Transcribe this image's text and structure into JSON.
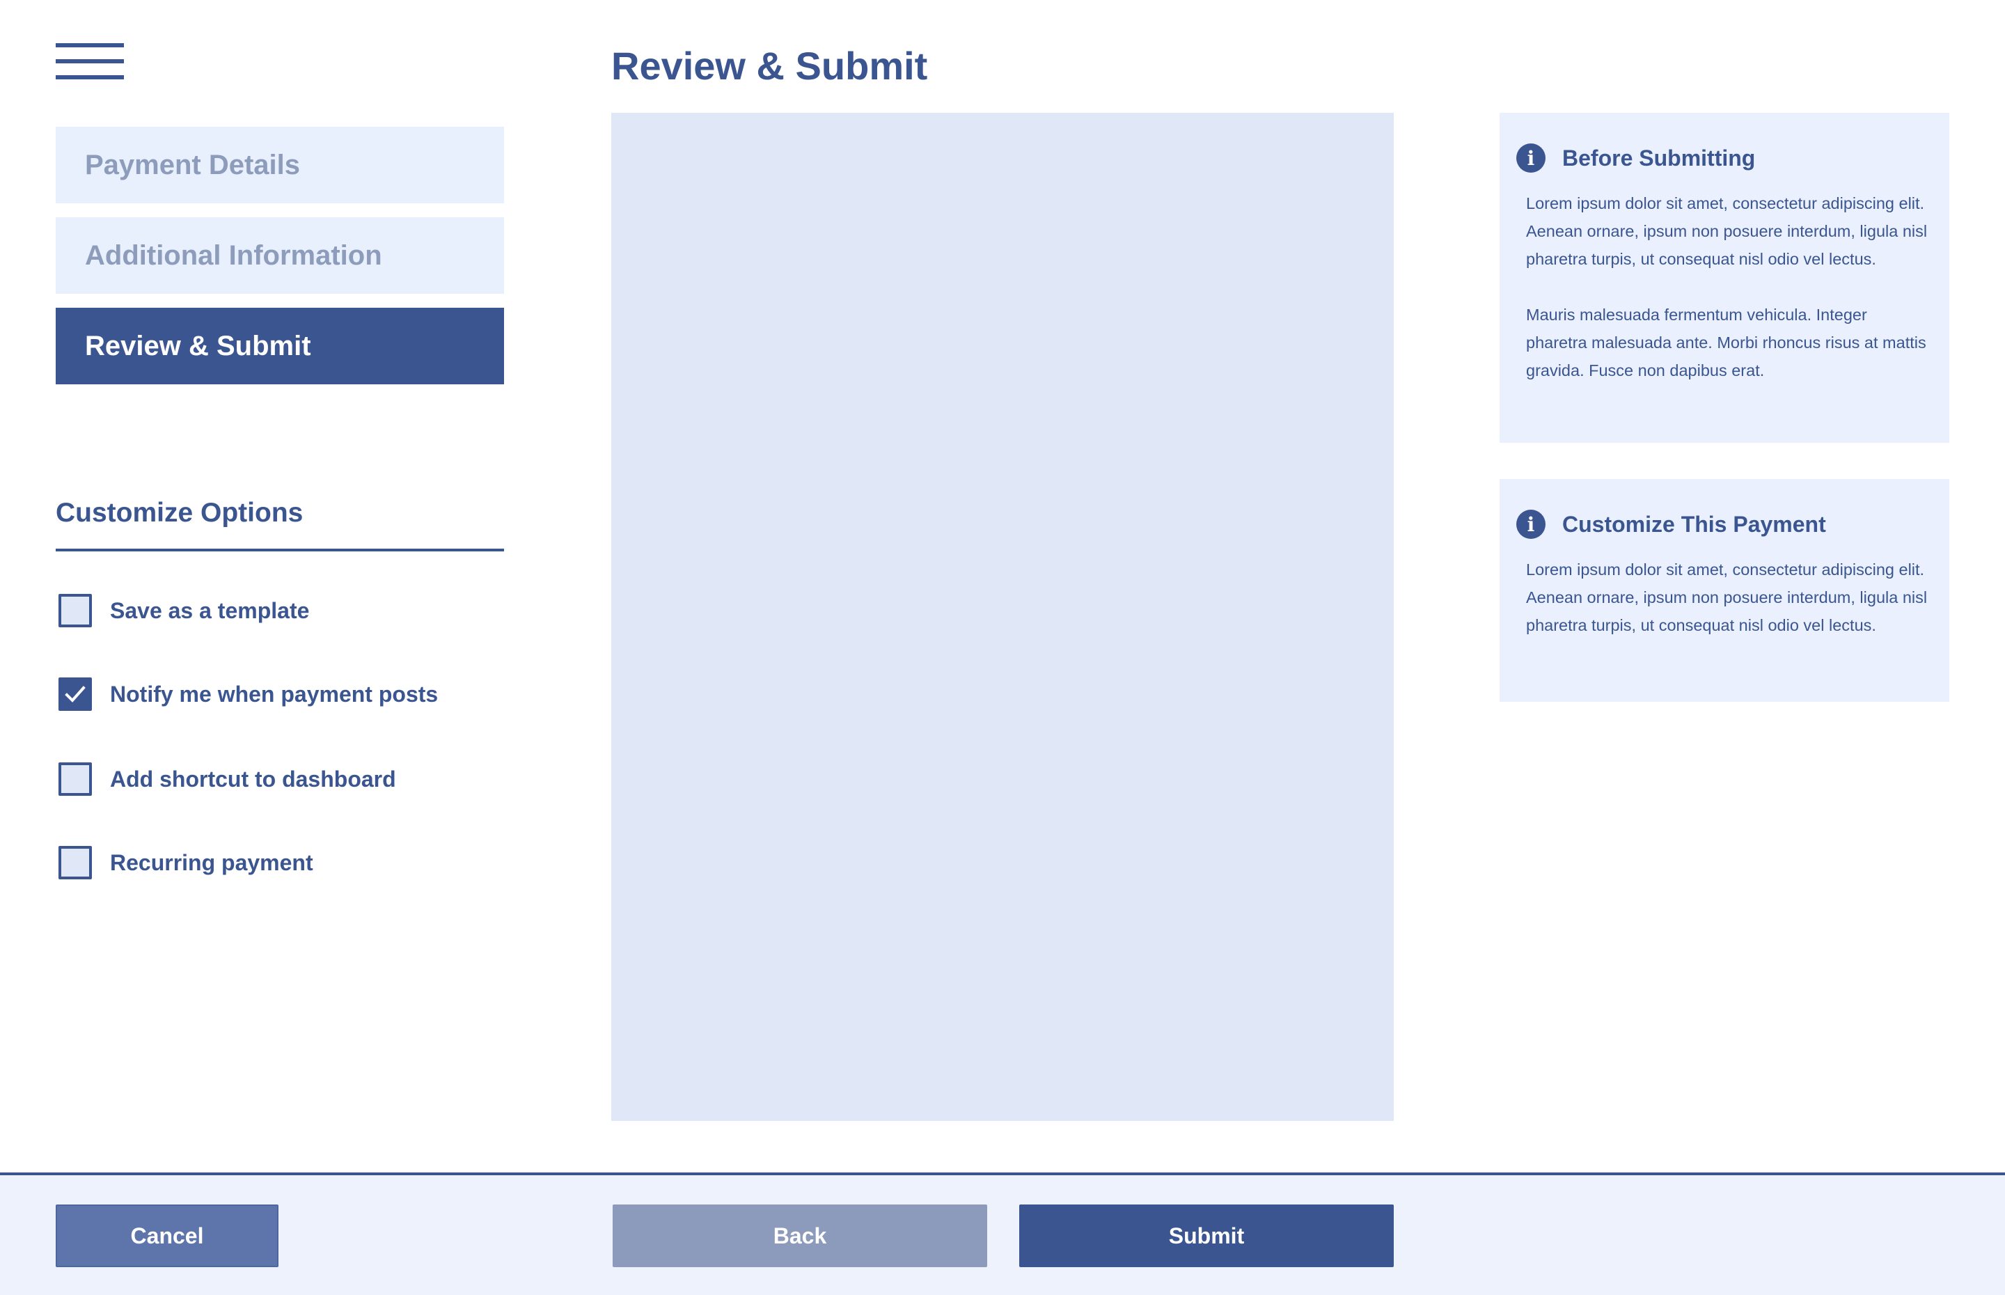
{
  "nav": {
    "menu_icon": "hamburger-menu-icon"
  },
  "steps": [
    {
      "label": "Payment Details",
      "state": "inactive"
    },
    {
      "label": "Additional Information",
      "state": "inactive"
    },
    {
      "label": "Review & Submit",
      "state": "active"
    }
  ],
  "customize": {
    "title": "Customize Options",
    "options": [
      {
        "label": "Save as a template",
        "checked": false
      },
      {
        "label": "Notify me when payment posts",
        "checked": true
      },
      {
        "label": "Add shortcut to dashboard",
        "checked": false
      },
      {
        "label": "Recurring payment",
        "checked": false
      }
    ]
  },
  "main": {
    "title": "Review & Submit"
  },
  "cards": [
    {
      "icon": "info-icon",
      "title": "Before Submitting",
      "paragraphs": [
        "Lorem ipsum dolor sit amet, consectetur adipiscing elit. Aenean ornare, ipsum non posuere interdum, ligula nisl pharetra turpis, ut consequat nisl odio vel lectus.",
        "Mauris malesuada fermentum vehicula. Integer pharetra malesuada ante. Morbi rhoncus risus at mattis gravida. Fusce non dapibus erat."
      ]
    },
    {
      "icon": "info-icon",
      "title": "Customize This Payment",
      "paragraphs": [
        "Lorem ipsum dolor sit amet, consectetur adipiscing elit. Aenean ornare, ipsum non posuere interdum, ligula nisl pharetra turpis, ut consequat nisl odio vel lectus."
      ]
    }
  ],
  "footer": {
    "cancel_label": "Cancel",
    "back_label": "Back",
    "submit_label": "Submit"
  },
  "colors": {
    "primary": "#3a5590",
    "step_inactive_bg": "#e9f0fd",
    "step_inactive_text": "#8d9cbb",
    "panel_bg": "#e0e7f6",
    "card_bg": "#eaf0fd",
    "footer_bg": "#eef2fc",
    "cancel_bg": "#5d75ab",
    "back_bg": "#8c9abc"
  }
}
